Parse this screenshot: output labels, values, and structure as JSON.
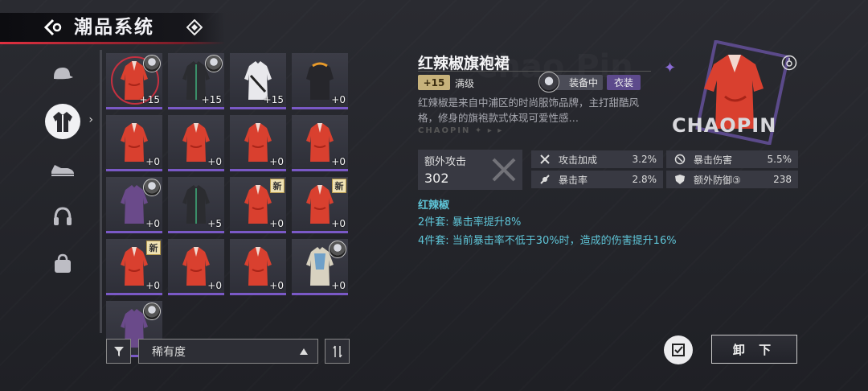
{
  "header": {
    "title": "潮品系统"
  },
  "categories": [
    {
      "name": "cap-icon",
      "active": false
    },
    {
      "name": "jacket-icon",
      "active": true
    },
    {
      "name": "shoes-icon",
      "active": false
    },
    {
      "name": "headphones-icon",
      "active": false
    },
    {
      "name": "bag-icon",
      "active": false
    }
  ],
  "grid": {
    "items": [
      {
        "kind": "red",
        "level": "+15",
        "avatar": true,
        "selected": true
      },
      {
        "kind": "black",
        "level": "+15",
        "avatar": true
      },
      {
        "kind": "white",
        "level": "+15"
      },
      {
        "kind": "hoodie",
        "level": "+0"
      },
      {
        "kind": "red",
        "level": "+0"
      },
      {
        "kind": "red",
        "level": "+0"
      },
      {
        "kind": "red",
        "level": "+0"
      },
      {
        "kind": "red",
        "level": "+0"
      },
      {
        "kind": "purple",
        "level": "+0",
        "avatar": true
      },
      {
        "kind": "black",
        "level": "+5"
      },
      {
        "kind": "red",
        "level": "+0",
        "new": "新"
      },
      {
        "kind": "red",
        "level": "+0",
        "new": "新"
      },
      {
        "kind": "red",
        "level": "+0",
        "new": "新"
      },
      {
        "kind": "red",
        "level": "+0"
      },
      {
        "kind": "red",
        "level": "+0"
      },
      {
        "kind": "cream",
        "level": "+0",
        "avatar": true
      },
      {
        "kind": "purple",
        "level": "",
        "avatar": true
      }
    ]
  },
  "sortbar": {
    "sort_label": "稀有度"
  },
  "detail": {
    "name": "红辣椒旗袍裙",
    "level_badge": "+15",
    "max_level": "满级",
    "equip_status": "装备中",
    "type": "衣装",
    "description": "红辣椒是来自中浦区的时尚服饰品牌，主打甜酷风格，修身的旗袍款式体现可爱性感…",
    "brand_strip": "CHAOPIN ✦ ▸ ▸",
    "brand_text": "CHAOPIN",
    "main_stat": {
      "label": "额外攻击",
      "value": "302"
    },
    "stats": [
      {
        "icon": "crossed-swords-icon",
        "name": "攻击加成",
        "value": "3.2%"
      },
      {
        "icon": "crit-damage-icon",
        "name": "暴击伤害",
        "value": "5.5%"
      },
      {
        "icon": "crit-rate-icon",
        "name": "暴击率",
        "value": "2.8%"
      },
      {
        "icon": "shield-icon",
        "name": "额外防御③",
        "value": "238"
      }
    ],
    "set": {
      "name": "红辣椒",
      "bonus2": "2件套: 暴击率提升8%",
      "bonus4": "4件套: 当前暴击率不低于30%时，造成的伤害提升16%"
    },
    "unequip_label": "卸 下"
  },
  "colors": {
    "accent_red": "#e03040",
    "rarity_purple": "#7a59c6",
    "set_cyan": "#5fc5d8",
    "gold_badge": "#c7b27b"
  }
}
